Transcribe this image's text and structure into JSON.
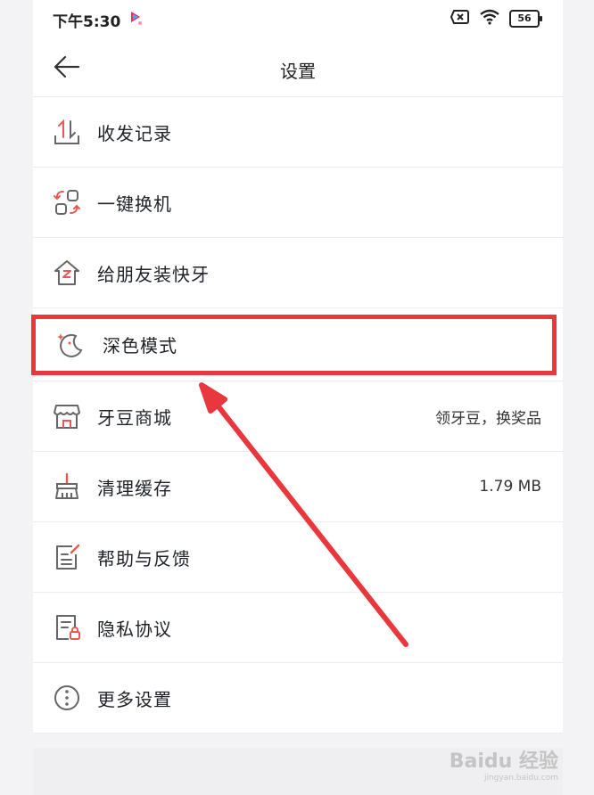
{
  "status_bar": {
    "time": "下午5:30",
    "battery": "56"
  },
  "header": {
    "title": "设置"
  },
  "rows": [
    {
      "label": "收发记录",
      "value": "",
      "icon": "transfer-icon"
    },
    {
      "label": "一键换机",
      "value": "",
      "icon": "switch-phone-icon"
    },
    {
      "label": "给朋友装快牙",
      "value": "",
      "icon": "house-z-icon"
    },
    {
      "label": "深色模式",
      "value": "",
      "icon": "moon-icon"
    },
    {
      "label": "牙豆商城",
      "value": "领牙豆，换奖品",
      "icon": "store-icon"
    },
    {
      "label": "清理缓存",
      "value": "1.79 MB",
      "icon": "broom-icon"
    },
    {
      "label": "帮助与反馈",
      "value": "",
      "icon": "feedback-icon"
    },
    {
      "label": "隐私协议",
      "value": "",
      "icon": "privacy-doc-icon"
    },
    {
      "label": "更多设置",
      "value": "",
      "icon": "more-dots-icon"
    }
  ],
  "colors": {
    "accent": "#e8383d",
    "icon_red": "#e85a4f",
    "icon_gray": "#666666"
  },
  "watermark": {
    "brand": "Baidu 经验",
    "site": "jingyan.baidu.com"
  }
}
